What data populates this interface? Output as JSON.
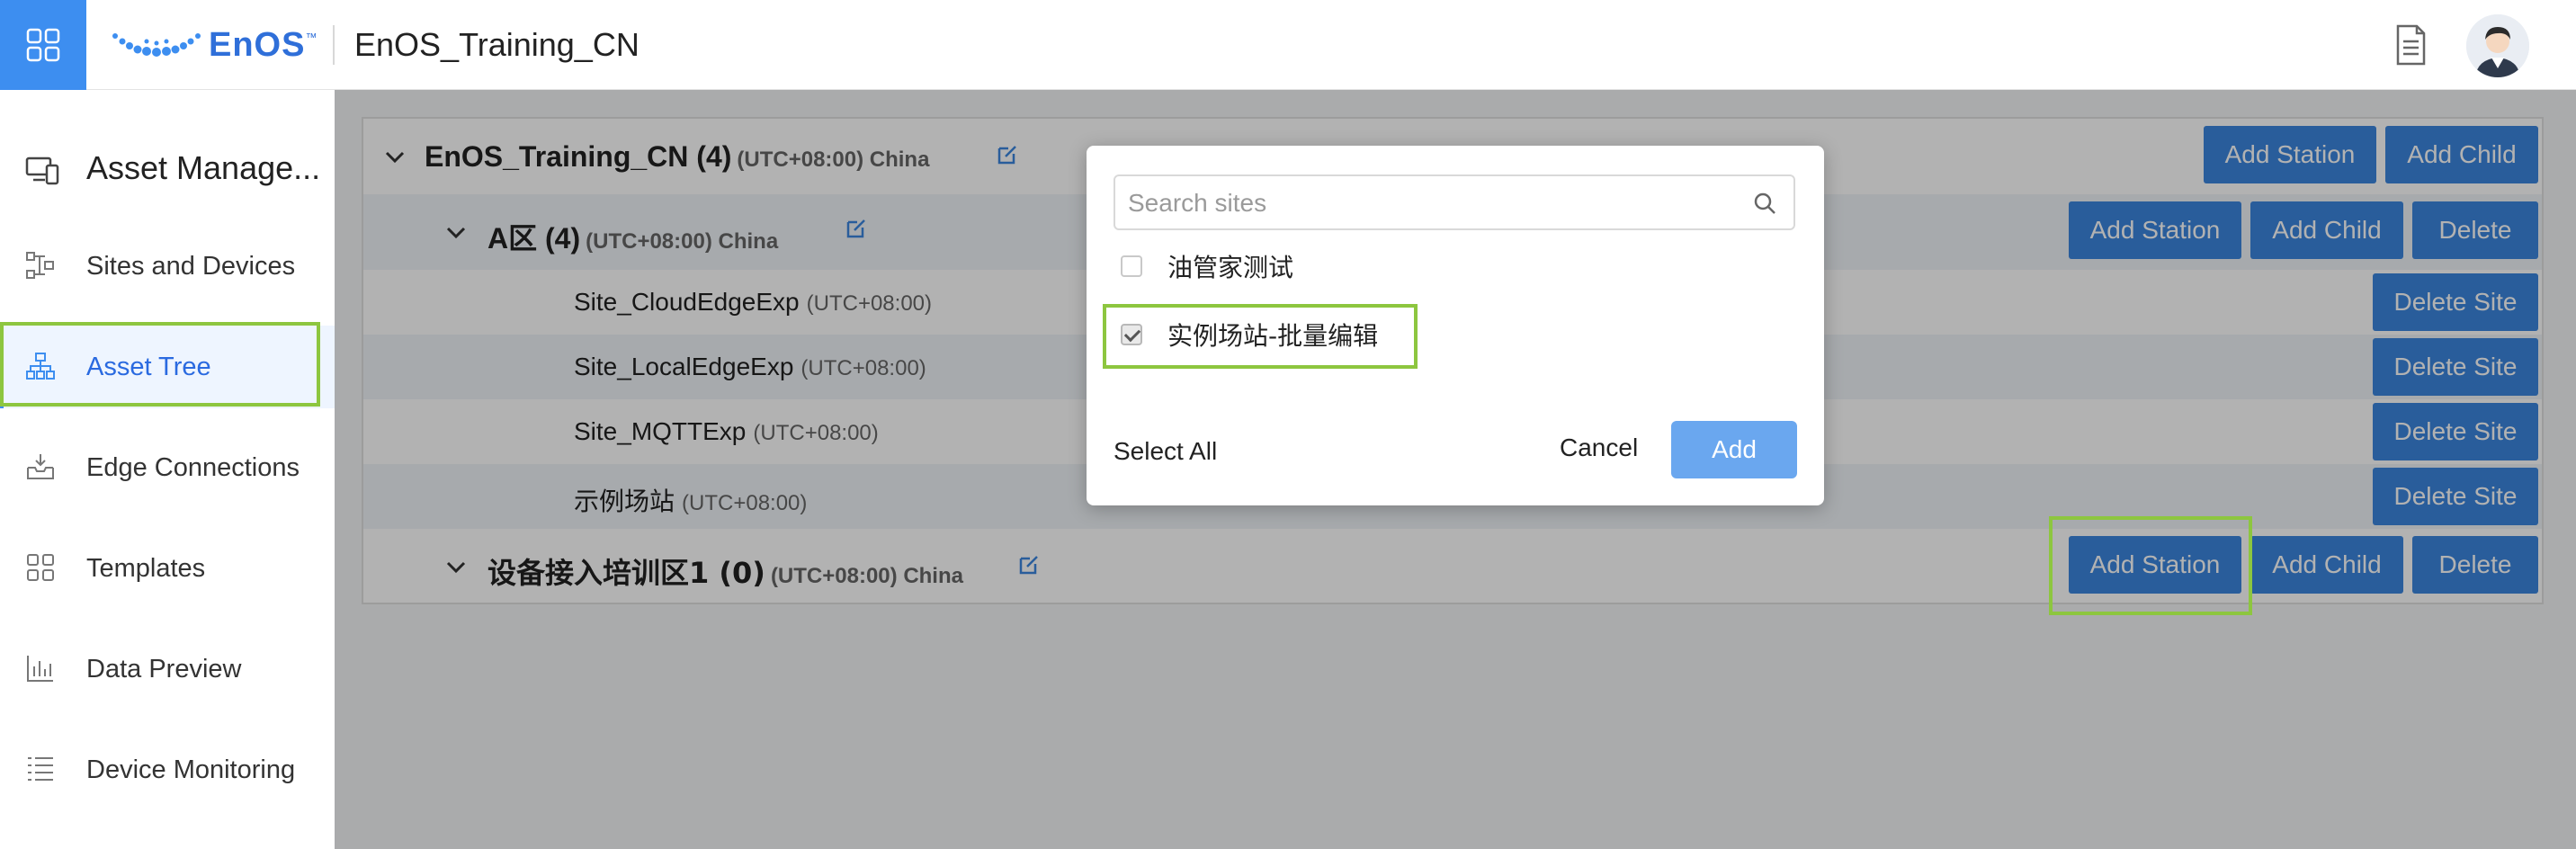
{
  "header": {
    "logo_text": "EnOS",
    "logo_tm": "™",
    "org_name": "EnOS_Training_CN"
  },
  "sidebar": {
    "title": "Asset Manage...",
    "items": [
      {
        "label": "Sites and Devices"
      },
      {
        "label": "Asset Tree"
      },
      {
        "label": "Edge Connections"
      },
      {
        "label": "Templates"
      },
      {
        "label": "Data Preview"
      },
      {
        "label": "Device Monitoring"
      }
    ]
  },
  "tree": {
    "root": {
      "name": "EnOS_Training_CN (4)",
      "tz": "(UTC+08:00) China"
    },
    "node_a": {
      "name": "A区 (4)",
      "tz": "(UTC+08:00) China"
    },
    "sites": [
      {
        "name": "Site_CloudEdgeExp",
        "tz": "(UTC+08:00)"
      },
      {
        "name": "Site_LocalEdgeExp",
        "tz": "(UTC+08:00)"
      },
      {
        "name": "Site_MQTTExp",
        "tz": "(UTC+08:00)"
      },
      {
        "name": "示例场站",
        "tz": "(UTC+08:00)"
      }
    ],
    "node_b": {
      "name": "设备接入培训区1 (0)",
      "tz": "(UTC+08:00) China"
    },
    "buttons": {
      "add_station": "Add Station",
      "add_child": "Add Child",
      "delete": "Delete",
      "delete_site": "Delete Site"
    }
  },
  "modal": {
    "search_placeholder": "Search sites",
    "options": [
      {
        "label": "油管家测试",
        "checked": false
      },
      {
        "label": "实例场站-批量编辑",
        "checked": true
      }
    ],
    "select_all": "Select All",
    "cancel": "Cancel",
    "add": "Add"
  },
  "colors": {
    "accent": "#3d8ef0",
    "button": "#3c86df",
    "highlight": "#8dc63f"
  }
}
